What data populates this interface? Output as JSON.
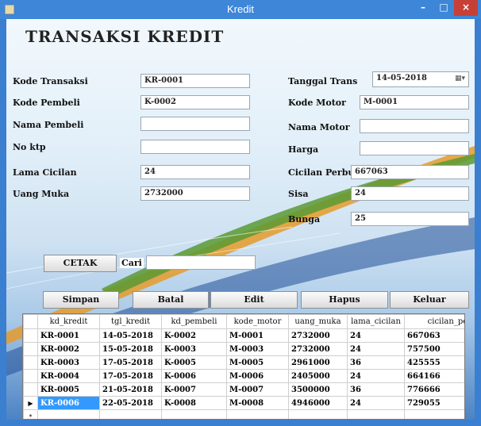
{
  "window": {
    "title": "Kredit",
    "min": "–",
    "max": "□",
    "close": "×"
  },
  "heading": "TRANSAKSI KREDIT",
  "form": {
    "kode_transaksi": {
      "label": "Kode Transaksi",
      "value": "KR-0001"
    },
    "kode_pembeli": {
      "label": "Kode Pembeli",
      "value": "K-0002"
    },
    "nama_pembeli": {
      "label": "Nama Pembeli",
      "value": ""
    },
    "no_ktp": {
      "label": "No ktp",
      "value": ""
    },
    "lama_cicilan": {
      "label": "Lama Cicilan",
      "value": "24"
    },
    "uang_muka": {
      "label": "Uang Muka",
      "value": "2732000"
    },
    "tanggal_trans": {
      "label": "Tanggal Trans",
      "value": "14-05-2018"
    },
    "kode_motor": {
      "label": "Kode Motor",
      "value": "M-0001"
    },
    "nama_motor": {
      "label": "Nama Motor",
      "value": ""
    },
    "harga": {
      "label": "Harga",
      "value": ""
    },
    "cicilan_perbulan": {
      "label": "Cicilan Perbulan",
      "value": "667063"
    },
    "sisa": {
      "label": "Sisa",
      "value": "24"
    },
    "bunga": {
      "label": "Bunga",
      "value": "25"
    }
  },
  "search": {
    "button": "CETAK",
    "label": "Cari",
    "value": ""
  },
  "buttons": {
    "simpan": "Simpan",
    "batal": "Batal",
    "edit": "Edit",
    "hapus": "Hapus",
    "keluar": "Keluar"
  },
  "grid": {
    "columns": [
      "kd_kredit",
      "tgl_kredit",
      "kd_pembeli",
      "kode_motor",
      "uang_muka",
      "lama_cicilan",
      "cicilan_perb"
    ],
    "rows": [
      [
        "KR-0001",
        "14-05-2018",
        "K-0002",
        "M-0001",
        "2732000",
        "24",
        "667063"
      ],
      [
        "KR-0002",
        "15-05-2018",
        "K-0003",
        "M-0003",
        "2732000",
        "24",
        "757500"
      ],
      [
        "KR-0003",
        "17-05-2018",
        "K-0005",
        "M-0005",
        "2961000",
        "36",
        "425555"
      ],
      [
        "KR-0004",
        "17-05-2018",
        "K-0006",
        "M-0006",
        "2405000",
        "24",
        "664166"
      ],
      [
        "KR-0005",
        "21-05-2018",
        "K-0007",
        "M-0007",
        "3500000",
        "36",
        "776666"
      ],
      [
        "KR-0006",
        "22-05-2018",
        "K-0008",
        "M-0008",
        "4946000",
        "24",
        "729055"
      ]
    ],
    "current_marker": "▶",
    "new_row_marker": "*"
  }
}
